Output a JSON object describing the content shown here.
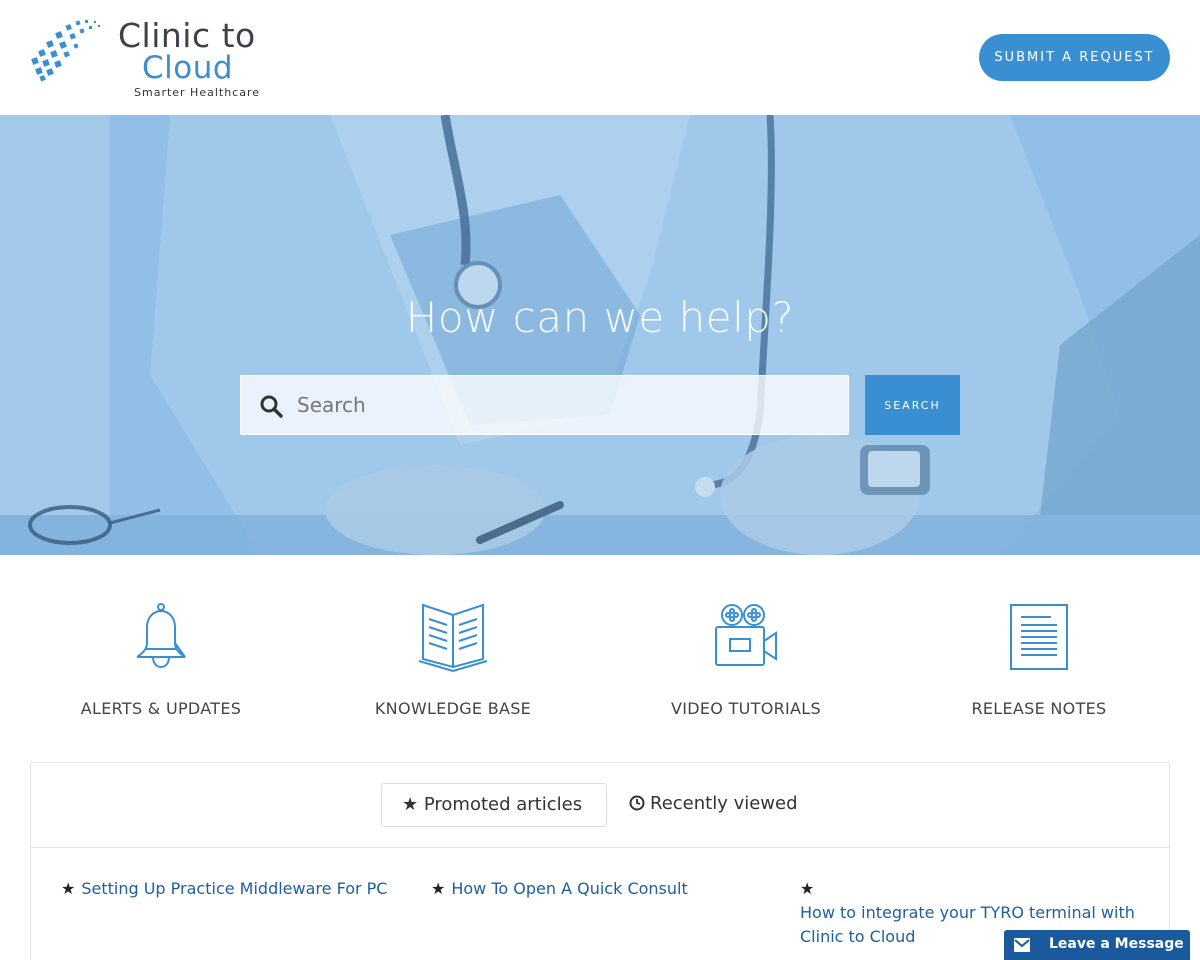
{
  "header": {
    "logo": {
      "line1": "Clinic to",
      "line2": "Cloud",
      "tagline": "Smarter Healthcare"
    },
    "submit_label": "SUBMIT A REQUEST"
  },
  "hero": {
    "title": "How can we help?",
    "search": {
      "placeholder": "Search",
      "value": "",
      "button_label": "SEARCH",
      "icon": "search-icon"
    }
  },
  "categories": [
    {
      "label": "ALERTS & UPDATES",
      "icon": "bell-icon"
    },
    {
      "label": "KNOWLEDGE BASE",
      "icon": "open-book-icon"
    },
    {
      "label": "VIDEO TUTORIALS",
      "icon": "video-camera-icon"
    },
    {
      "label": "RELEASE NOTES",
      "icon": "document-icon"
    }
  ],
  "articles_panel": {
    "tabs": [
      {
        "label": "★ Promoted articles",
        "active": true
      },
      {
        "label": "Recently viewed",
        "active": false,
        "icon": "clock-icon"
      }
    ],
    "articles": [
      {
        "star": "★",
        "title": "Setting Up Practice Middleware For PC"
      },
      {
        "star": "★",
        "title": "How To Open A Quick Consult"
      },
      {
        "star": "★",
        "title": "How to integrate your TYRO terminal with Clinic to Cloud"
      }
    ]
  },
  "widget": {
    "label": "Leave a Message",
    "icon": "envelope-icon"
  },
  "colors": {
    "brand_blue": "#3a8fd3",
    "link_blue": "#1f5fa0",
    "widget_blue": "#1a5a9c"
  }
}
